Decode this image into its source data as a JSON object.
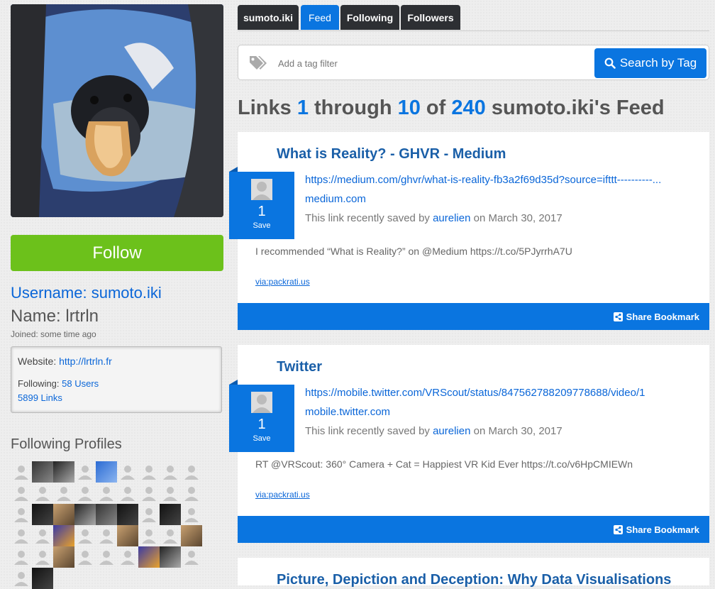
{
  "profile": {
    "username_label": "Username: sumoto.iki",
    "name_label": "Name: lrtrln",
    "joined": "Joined: some time ago",
    "follow_label": "Follow",
    "website_label": "Website:",
    "website_url": "http://lrtrln.fr",
    "following_label": "Following:",
    "following_count": "58 Users",
    "links_count": "5899 Links",
    "following_profiles_title": "Following Profiles"
  },
  "tabs": [
    {
      "label": "sumoto.iki",
      "active": false
    },
    {
      "label": "Feed",
      "active": true
    },
    {
      "label": "Following",
      "active": false
    },
    {
      "label": "Followers",
      "active": false
    }
  ],
  "search": {
    "placeholder": "Add a tag filter",
    "button_label": "Search by Tag",
    "icon": "tags-icon"
  },
  "feed_title": {
    "prefix": "Links",
    "start": "1",
    "through": "through",
    "end": "10",
    "of": "of",
    "total": "240",
    "suffix": "sumoto.iki's Feed"
  },
  "cards": [
    {
      "title": "What is Reality? - GHVR - Medium",
      "url": "https://medium.com/ghvr/what-is-reality-fb3a2f69d35d?source=ifttt----------...",
      "domain": "medium.com",
      "saved_prefix": "This link recently saved by",
      "saved_user": "aurelien",
      "saved_date": "on March 30, 2017",
      "save_count": "1",
      "save_label": "Save",
      "description": "I recommended “What is Reality?” on @Medium https://t.co/5PJyrrhA7U",
      "via": "via:packrati.us",
      "share_label": "Share Bookmark"
    },
    {
      "title": "Twitter",
      "url": "https://mobile.twitter.com/VRScout/status/847562788209778688/video/1",
      "domain": "mobile.twitter.com",
      "saved_prefix": "This link recently saved by",
      "saved_user": "aurelien",
      "saved_date": "on March 30, 2017",
      "save_count": "1",
      "save_label": "Save",
      "description": "RT @VRScout: 360° Camera + Cat = Happiest VR Kid Ever https://t.co/v6HpCMIEWn",
      "via": "via:packrati.us",
      "share_label": "Share Bookmark"
    },
    {
      "title": "Picture, Depiction and Deception: Why Data Visualisations"
    }
  ],
  "following_grid": [
    "p",
    "img1",
    "img3",
    "p",
    "img2",
    "p",
    "p",
    "p",
    "p",
    "p",
    "p",
    "p",
    "p",
    "p",
    "p",
    "p",
    "p",
    "p",
    "p",
    "img4",
    "img5",
    "img3",
    "img1",
    "img4",
    "p",
    "img4",
    "p",
    "p",
    "p",
    "img6",
    "p",
    "p",
    "img5",
    "p",
    "p",
    "img5",
    "p",
    "p",
    "img5",
    "p",
    "p",
    "p",
    "img6",
    "img3",
    "p",
    "p",
    "img4"
  ],
  "colors": {
    "accent": "#0a75e0",
    "follow_green": "#6cc11b",
    "dark_tab": "#2d2f33",
    "title_blue": "#1a5fa8"
  }
}
